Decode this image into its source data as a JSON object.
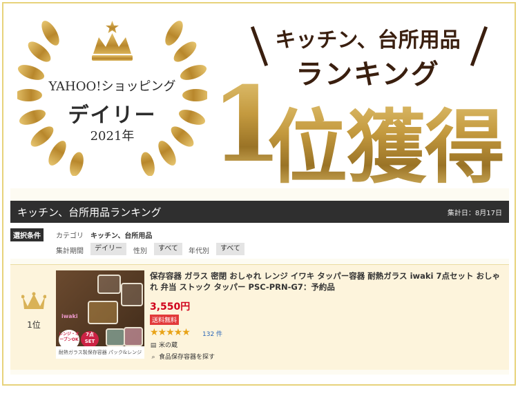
{
  "badge": {
    "line1": "YAHOO!ショッピング",
    "line2": "デイリー",
    "line3": "2021年"
  },
  "headline": {
    "line1": "キッチン、台所用品",
    "line2": "ランキング",
    "number": "1",
    "suffix": "位獲得"
  },
  "panel": {
    "title": "キッチン、台所用品ランキング",
    "date": "集計日：8月17日",
    "cond_tag": "選択条件",
    "category_label": "カテゴリ",
    "category_value": "キッチン、台所用品",
    "period_label": "集計期間",
    "period_value": "デイリー",
    "gender_label": "性別",
    "gender_value": "すべて",
    "age_label": "年代別",
    "age_value": "すべて"
  },
  "item": {
    "rank": "1位",
    "thumb_caption": "耐熱ガラス製保存容器 パック&レンジ",
    "thumb_brand": "iwaki",
    "thumb_seal1": "レンジ・オーブンOK",
    "thumb_seal2": "7点SET",
    "title": "保存容器 ガラス 密閉 おしゃれ レンジ イワキ タッパー容器 耐熱ガラス iwaki 7点セット おしゃれ 弁当 ストック タッパー PSC-PRN-G7：予約品",
    "price": "3,550円",
    "shipping": "送料無料",
    "stars": "★★★★★",
    "rating": 4.5,
    "review_count": "132 件",
    "store": "米の蔵",
    "search_link": "食品保存容器を探す"
  },
  "colors": {
    "gold": "#c49a3f",
    "dark": "#2f2f2f",
    "price": "#d0021b",
    "accent_border": "#e7d27a"
  }
}
